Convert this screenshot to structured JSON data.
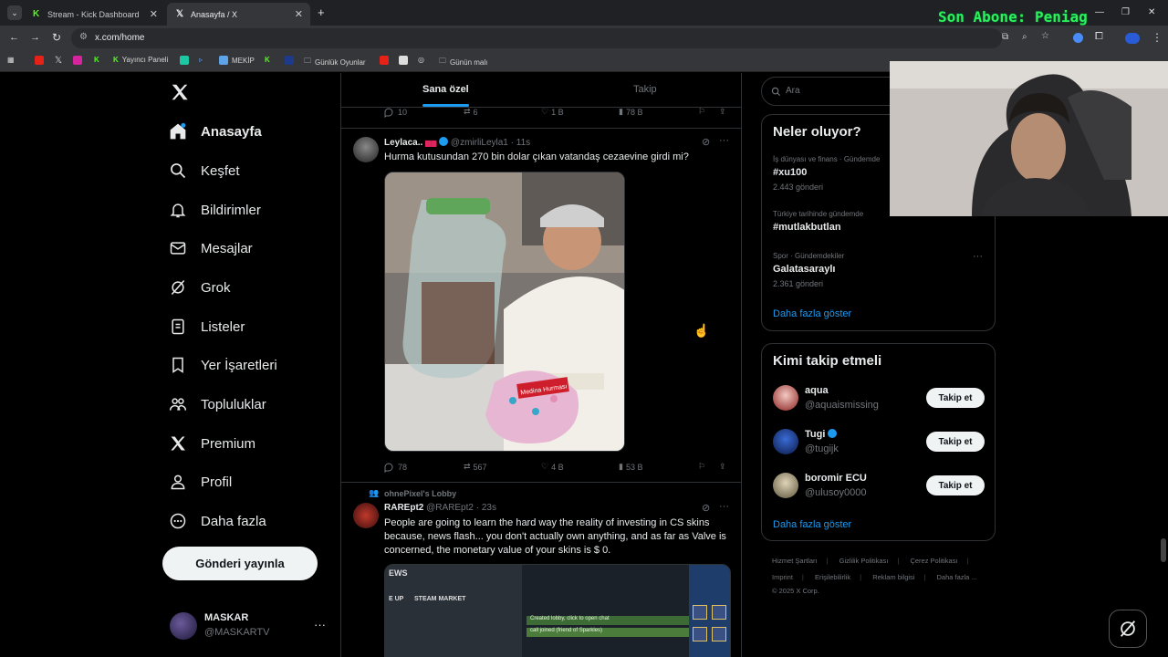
{
  "browser": {
    "tabs": [
      {
        "label": "Stream - Kick Dashboard",
        "favicon": "kick-icon"
      },
      {
        "label": "Anasayfa / X",
        "favicon": "x-logo-icon"
      }
    ],
    "address": "x.com/home",
    "bookmarks": [
      "Yayıncı Paneli",
      "MEKİP",
      "Günlük Oyunlar",
      "Günün malı"
    ]
  },
  "overlay": {
    "subscriber_text": "Son Abone: Peniag"
  },
  "sidebar": {
    "items": [
      {
        "label": "Anasayfa",
        "icon": "home-icon"
      },
      {
        "label": "Keşfet",
        "icon": "search-icon"
      },
      {
        "label": "Bildirimler",
        "icon": "bell-icon"
      },
      {
        "label": "Mesajlar",
        "icon": "mail-icon"
      },
      {
        "label": "Grok",
        "icon": "grok-icon"
      },
      {
        "label": "Listeler",
        "icon": "list-icon"
      },
      {
        "label": "Yer İşaretleri",
        "icon": "bookmark-icon"
      },
      {
        "label": "Topluluklar",
        "icon": "communities-icon"
      },
      {
        "label": "Premium",
        "icon": "x-logo-icon"
      },
      {
        "label": "Profil",
        "icon": "user-icon"
      },
      {
        "label": "Daha fazla",
        "icon": "more-circle-icon"
      }
    ],
    "post_button": "Gönderi yayınla",
    "account": {
      "name": "MASKAR",
      "handle": "@MASKARTV"
    }
  },
  "feed": {
    "tabs": [
      "Sana özel",
      "Takip"
    ],
    "prev_actions": {
      "replies": "10",
      "reposts": "6",
      "likes": "1 B",
      "views": "78 B"
    },
    "tweet1": {
      "name": "Leylaca..",
      "handle": "@zmirliLeyla1",
      "time": "· 11s",
      "text": "Hurma kutusundan 270 bin dolar çıkan vatandaş cezaevine girdi mi?",
      "media_label": "Medina Hurması",
      "actions": {
        "replies": "78",
        "reposts": "567",
        "likes": "4 B",
        "views": "53 B"
      }
    },
    "tweet2": {
      "context": "ohnePixel's Lobby",
      "name": "RAREpt2",
      "handle": "@RAREpt2",
      "time": "· 23s",
      "text": "People are going to learn the hard way the reality of investing in CS skins because, news flash... you don't actually own anything, and as far as Valve is concerned, the monetary value of your skins is $ 0.",
      "media_texts": [
        "EWS",
        "E UP",
        "STEAM MARKET",
        "Created lobby, click to open chat",
        "call joined (friend of Sparkles)"
      ]
    }
  },
  "right": {
    "search_placeholder": "Ara",
    "trends_title": "Neler oluyor?",
    "trends": [
      {
        "category": "İş dünyası ve finans · Gündemde",
        "name": "#xu100",
        "count": "2.443 gönderi"
      },
      {
        "category": "Türkiye tarihinde gündemde",
        "name": "#mutlakbutlan",
        "count": ""
      },
      {
        "category": "Spor · Gündemdekiler",
        "name": "Galatasaraylı",
        "count": "2.361 gönderi"
      }
    ],
    "show_more": "Daha fazla göster",
    "follow_title": "Kimi takip etmeli",
    "follows": [
      {
        "name": "aqua",
        "handle": "@aquaismissing",
        "button": "Takip et"
      },
      {
        "name": "Tugi",
        "handle": "@tugijk",
        "button": "Takip et"
      },
      {
        "name": "boromir ECU",
        "handle": "@ulusoy0000",
        "button": "Takip et"
      }
    ],
    "footer": [
      "Hizmet Şartları",
      "Gizlilik Politikası",
      "Çerez Politikası",
      "Imprint",
      "Erişilebilirlik",
      "Reklam bilgisi",
      "Daha fazla ...",
      "© 2025 X Corp."
    ]
  },
  "colors": {
    "accent": "#1d9bf0",
    "overlay_green": "#2bf25a",
    "background": "#000000"
  }
}
